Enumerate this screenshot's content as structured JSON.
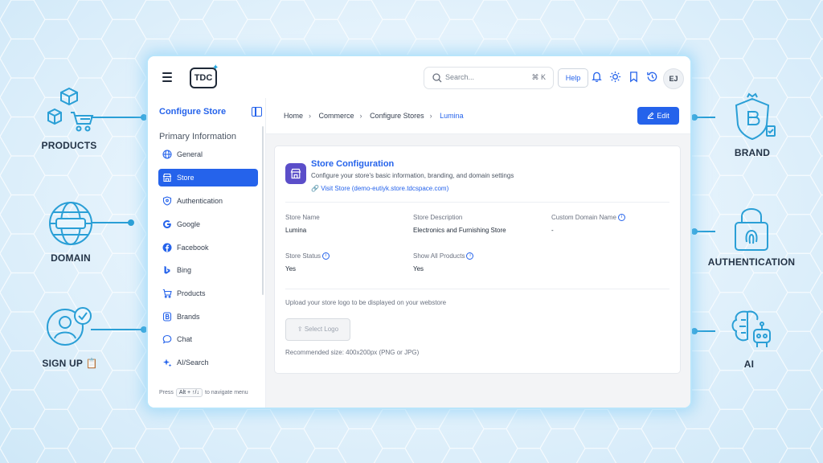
{
  "features": {
    "products": "PRODUCTS",
    "domain": "DOMAIN",
    "signup": "SIGN UP",
    "brand": "BRAND",
    "authentication": "AUTHENTICATION",
    "ai": "AI"
  },
  "topbar": {
    "logo_text": "TDC",
    "search_placeholder": "Search...",
    "search_shortcut": "⌘ K",
    "help_label": "Help",
    "avatar_initials": "EJ"
  },
  "sidebar": {
    "title": "Configure Store",
    "section": "Primary Information",
    "items": [
      {
        "label": "General",
        "icon": "globe-icon"
      },
      {
        "label": "Store",
        "icon": "store-icon",
        "active": true
      },
      {
        "label": "Authentication",
        "icon": "shield-icon"
      },
      {
        "label": "Google",
        "icon": "google-icon"
      },
      {
        "label": "Facebook",
        "icon": "facebook-icon"
      },
      {
        "label": "Bing",
        "icon": "bing-icon"
      },
      {
        "label": "Products",
        "icon": "cart-icon"
      },
      {
        "label": "Brands",
        "icon": "brand-icon"
      },
      {
        "label": "Chat",
        "icon": "chat-icon"
      },
      {
        "label": "AI/Search",
        "icon": "sparkle-icon"
      }
    ],
    "hint_prefix": "Press",
    "hint_key": "Alt + ↑/↓",
    "hint_suffix": "to navigate menu"
  },
  "breadcrumb": [
    "Home",
    "Commerce",
    "Configure Stores",
    "Lumina"
  ],
  "edit_label": "Edit",
  "card": {
    "title": "Store Configuration",
    "subtitle": "Configure your store's basic information, branding, and domain settings",
    "visit_link": "Visit Store (demo-eutiyk.store.tdcspace.com)",
    "fields": {
      "store_name_label": "Store Name",
      "store_name_value": "Lumina",
      "store_desc_label": "Store Description",
      "store_desc_value": "Electronics and Furnishing Store",
      "custom_domain_label": "Custom Domain Name",
      "custom_domain_value": "-",
      "store_status_label": "Store Status",
      "store_status_value": "Yes",
      "show_all_label": "Show All Products",
      "show_all_value": "Yes"
    },
    "upload_text": "Upload your store logo to be displayed on your webstore",
    "select_logo_label": "Select Logo",
    "recommended": "Recommended size: 400x200px (PNG or JPG)"
  },
  "colors": {
    "accent": "#2563eb",
    "feature_icon": "#2a9fd6",
    "store_icon_bg": "#5b4ec9"
  }
}
